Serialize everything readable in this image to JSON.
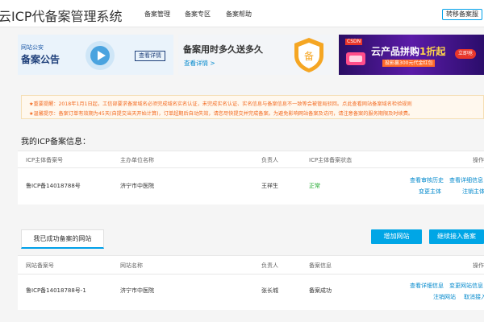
{
  "header": {
    "title": "云ICP代备案管理系统",
    "nav": [
      "备案管理",
      "备案专区",
      "备案帮助"
    ],
    "transfer_button": "转移备案服"
  },
  "banners": {
    "b1": {
      "tag": "网站公安",
      "title": "备案公告",
      "button": "查看详情"
    },
    "b2": {
      "title": "备案用时多久送多久",
      "link": "查看详情 >"
    },
    "b3": {
      "brand": "CSDN",
      "title_a": "云产品拼购",
      "title_b": "1折起",
      "subtitle": "投影赢300元代金红包",
      "action": "立即抢"
    }
  },
  "notice": {
    "line1": "★重要提醒：2018年1月1日起，工信部要求备案域名必须完成域名实名认证，未完成实名认证、实名信息与备案信息不一致等会被管局驳回。点此查看网站备案域名检验规则",
    "line2": "★温馨提示：备案订单有效期为45天(自提交当天开始计算)，订单超期后自动失效，请您尽快提交并完成备案。为避免影响网站备案及访问，请注意备案的服务期限及时续费。"
  },
  "icp_info": {
    "title": "我的ICP备案信息：",
    "headers": [
      "ICP主体备案号",
      "主办单位名称",
      "负责人",
      "ICP主体备案状态",
      "操作"
    ],
    "row": {
      "icp_no": "鲁ICP备14018788号",
      "org": "济宁市中医院",
      "person": "王祥生",
      "status": "正常",
      "ops": [
        "查看审核历史",
        "查看详细信息",
        "变更主体",
        "注销主体"
      ]
    }
  },
  "websites": {
    "tab": "我已成功备案的网站",
    "buttons": [
      "增加网站",
      "继续接入备案"
    ],
    "headers": [
      "网站备案号",
      "网站名称",
      "负责人",
      "备案信息",
      "操作"
    ],
    "row": {
      "site_no": "鲁ICP备14018788号-1",
      "name": "济宁市中医院",
      "person": "张长城",
      "info": "备案成功",
      "ops": [
        "查看详细信息",
        "变更网站信息",
        "注销网站",
        "取消接入"
      ]
    }
  },
  "colors": {
    "accent": "#00a6e6",
    "link": "#0088cc",
    "warning": "#f36b22",
    "success": "#1da72b"
  }
}
